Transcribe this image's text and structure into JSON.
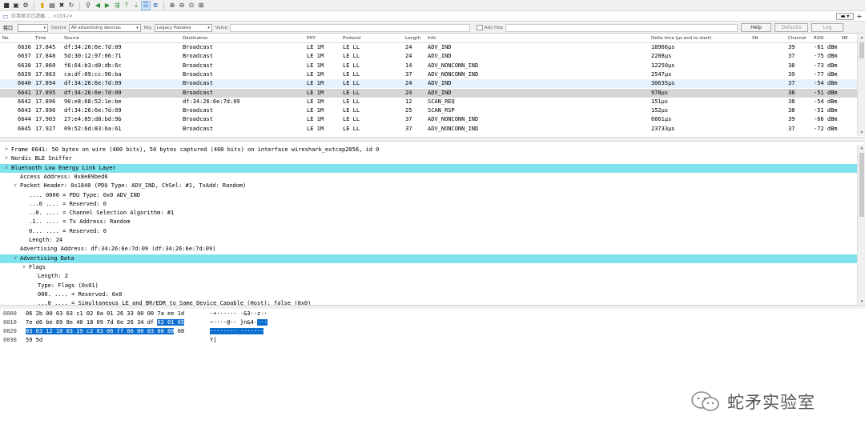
{
  "toolbar": {
    "icons": [
      "stop-icon",
      "restart-icon",
      "options-icon",
      "open-icon",
      "save-icon",
      "close-file-icon",
      "reload-icon",
      "find-icon",
      "go-back-icon",
      "go-forward-icon",
      "go-to-packet-icon",
      "go-first-icon",
      "go-last-icon",
      "auto-scroll-icon",
      "colorize-icon",
      "zoom-in-icon",
      "zoom-out-icon",
      "zoom-normal-icon",
      "resize-columns-icon"
    ]
  },
  "filter": {
    "placeholder": "应用显示过滤器 … <Ctrl-/>"
  },
  "iface": {
    "label": "接口",
    "device_label": "Device",
    "device_value": "All advertising devices",
    "key_label": "Key",
    "key_value": "Legacy Passkey",
    "value_label": "Value",
    "adv_hop_label": "Adv Hop",
    "help": "Help",
    "defaults": "Defaults",
    "log": "Log"
  },
  "columns": {
    "no": "No.",
    "time": "Time",
    "source": "Source",
    "destination": "Destination",
    "phy": "PHY",
    "protocol": "Protocol",
    "length": "Length",
    "info": "Info",
    "delta": "Delta time (µs end to start)",
    "sn": "SN",
    "channel": "Channel",
    "rssi": "RSSI",
    "ne": "NE"
  },
  "packets": [
    {
      "no": "6636",
      "time": "17.845",
      "src": "df:34:26:6e:7d:09",
      "dst": "Broadcast",
      "phy": "LE 1M",
      "proto": "LE LL",
      "len": "24",
      "info": "ADV_IND",
      "delta": "18966µs",
      "ch": "39",
      "rssi": "-61 dBm"
    },
    {
      "no": "6637",
      "time": "17.848",
      "src": "5d:30:12:97:66:71",
      "dst": "Broadcast",
      "phy": "LE 1M",
      "proto": "LE LL",
      "len": "24",
      "info": "ADV_IND",
      "delta": "2208µs",
      "ch": "37",
      "rssi": "-75 dBm"
    },
    {
      "no": "6638",
      "time": "17.860",
      "src": "f6:64:b3:d0:db:6c",
      "dst": "Broadcast",
      "phy": "LE 1M",
      "proto": "LE LL",
      "len": "14",
      "info": "ADV_NONCONN_IND",
      "delta": "12250µs",
      "ch": "38",
      "rssi": "-73 dBm"
    },
    {
      "no": "6639",
      "time": "17.863",
      "src": "ca:df:09:cc:90:ba",
      "dst": "Broadcast",
      "phy": "LE 1M",
      "proto": "LE LL",
      "len": "37",
      "info": "ADV_NONCONN_IND",
      "delta": "2547µs",
      "ch": "39",
      "rssi": "-77 dBm"
    },
    {
      "no": "6640",
      "time": "17.894",
      "src": "df:34:26:6e:7d:09",
      "dst": "Broadcast",
      "phy": "LE 1M",
      "proto": "LE LL",
      "len": "24",
      "info": "ADV_IND",
      "delta": "30635µs",
      "ch": "37",
      "rssi": "-54 dBm"
    },
    {
      "no": "6641",
      "time": "17.895",
      "src": "df:34:26:6e:7d:09",
      "dst": "Broadcast",
      "phy": "LE 1M",
      "proto": "LE LL",
      "len": "24",
      "info": "ADV_IND",
      "delta": "978µs",
      "ch": "38",
      "rssi": "-51 dBm"
    },
    {
      "no": "6642",
      "time": "17.896",
      "src": "90:e8:68:52:1e:be",
      "dst": "df:34:26:6e:7d:09",
      "phy": "LE 1M",
      "proto": "LE LL",
      "len": "12",
      "info": "SCAN_REQ",
      "delta": "151µs",
      "ch": "38",
      "rssi": "-54 dBm"
    },
    {
      "no": "6643",
      "time": "17.896",
      "src": "df:34:26:6e:7d:09",
      "dst": "Broadcast",
      "phy": "LE 1M",
      "proto": "LE LL",
      "len": "25",
      "info": "SCAN_RSP",
      "delta": "152µs",
      "ch": "38",
      "rssi": "-51 dBm"
    },
    {
      "no": "6644",
      "time": "17.903",
      "src": "27:e4:85:d8:bd:9b",
      "dst": "Broadcast",
      "phy": "LE 1M",
      "proto": "LE LL",
      "len": "37",
      "info": "ADV_NONCONN_IND",
      "delta": "6661µs",
      "ch": "39",
      "rssi": "-66 dBm"
    },
    {
      "no": "6645",
      "time": "17.927",
      "src": "09:52:6d:83:6a:61",
      "dst": "Broadcast",
      "phy": "LE 1M",
      "proto": "LE LL",
      "len": "37",
      "info": "ADV_NONCONN_IND",
      "delta": "23733µs",
      "ch": "37",
      "rssi": "-72 dBm"
    }
  ],
  "details": [
    {
      "indent": 0,
      "tog": ">",
      "text": "Frame 6641: 50 bytes on wire (400 bits), 50 bytes captured (400 bits) on interface wireshark_extcap2056, id 0",
      "hl": false
    },
    {
      "indent": 0,
      "tog": ">",
      "text": "Nordic BLE Sniffer",
      "hl": false
    },
    {
      "indent": 0,
      "tog": "v",
      "text": "Bluetooth Low Energy Link Layer",
      "hl": true
    },
    {
      "indent": 1,
      "tog": "",
      "text": "Access Address: 0x8e89bed6",
      "hl": false
    },
    {
      "indent": 1,
      "tog": "v",
      "text": "Packet Header: 0x1840 (PDU Type: ADV_IND, ChSel: #1, TxAdd: Random)",
      "hl": false
    },
    {
      "indent": 2,
      "tog": "",
      "text": ".... 0000 = PDU Type: 0x0 ADV_IND",
      "hl": false
    },
    {
      "indent": 2,
      "tog": "",
      "text": "...0 .... = Reserved: 0",
      "hl": false
    },
    {
      "indent": 2,
      "tog": "",
      "text": "..0. .... = Channel Selection Algorithm: #1",
      "hl": false
    },
    {
      "indent": 2,
      "tog": "",
      "text": ".1.. .... = Tx Address: Random",
      "hl": false
    },
    {
      "indent": 2,
      "tog": "",
      "text": "0... .... = Reserved: 0",
      "hl": false
    },
    {
      "indent": 2,
      "tog": "",
      "text": "Length: 24",
      "hl": false
    },
    {
      "indent": 1,
      "tog": "",
      "text": "Advertising Address: df:34:26:6e:7d:09 (df:34:26:6e:7d:09)",
      "hl": false
    },
    {
      "indent": 1,
      "tog": "v",
      "text": "Advertising Data",
      "hl": true
    },
    {
      "indent": 2,
      "tog": "v",
      "text": "Flags",
      "hl": false
    },
    {
      "indent": 3,
      "tog": "",
      "text": "Length: 2",
      "hl": false
    },
    {
      "indent": 3,
      "tog": "",
      "text": "Type: Flags (0x01)",
      "hl": false
    },
    {
      "indent": 3,
      "tog": "",
      "text": "000. .... = Reserved: 0x0",
      "hl": false
    },
    {
      "indent": 3,
      "tog": "",
      "text": "...0 .... = Simultaneous LE and BR/EDR to Same Device Capable (Host): false (0x0)",
      "hl": false
    }
  ],
  "bytes": [
    {
      "off": "0000",
      "hex_plain": "06 2b 00 03 03 c1 02 0a  01 26 33 00 00 7a ee 1d",
      "hex_hl": "",
      "hex_after": "",
      "asc_plain": "·+······ ·&3··z··",
      "asc_hl": ""
    },
    {
      "off": "0010",
      "hex_plain": "7e d6 be 89 8e 40 18 09  7d 6e 26 34 df",
      "hex_hl": "02 01 05",
      "hex_after": "",
      "asc_plain": "~····@·· }n&4·",
      "asc_hl": "···"
    },
    {
      "off": "0020",
      "hex_plain": "",
      "hex_hl": "03 03 12 18 03 19 c2 03  06 ff 06 00 03 00 80",
      "hex_after": " 08",
      "asc_plain": "",
      "asc_hl": "········ ·······"
    },
    {
      "off": "0030",
      "hex_plain": "59 5d",
      "hex_hl": "",
      "hex_after": "",
      "asc_plain": "Y]",
      "asc_hl": ""
    }
  ],
  "watermark": {
    "text": "蛇矛实验室"
  }
}
